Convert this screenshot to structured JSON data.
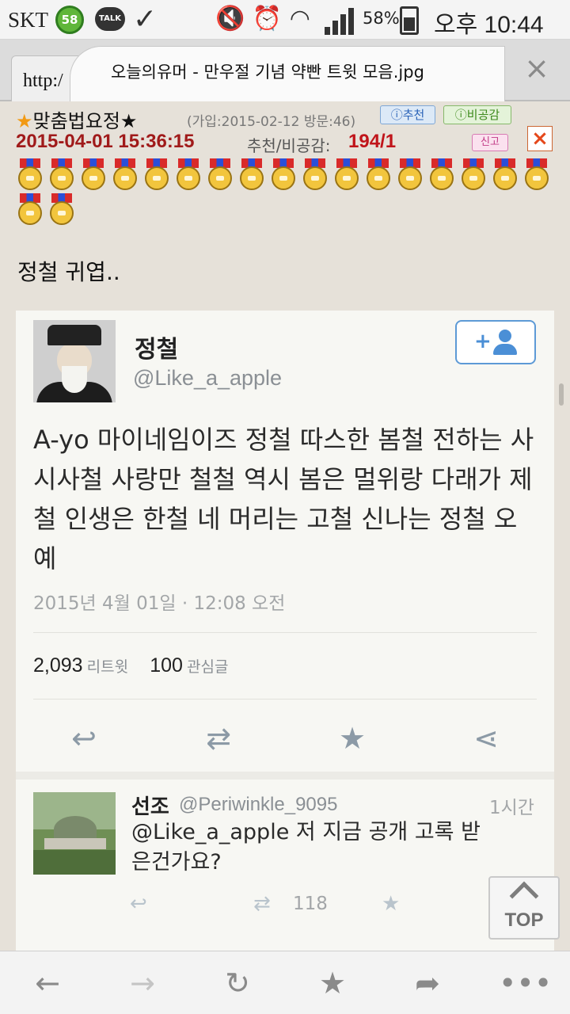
{
  "status_bar": {
    "carrier": "SKT",
    "badge": "58",
    "talk": "TALK",
    "battery_pct": "58%",
    "time": "오후 10:44"
  },
  "browser": {
    "url_stub": "http:/",
    "tab_title": "오늘의유머 - 만우절 기념 약빤 트윗 모음.jpg",
    "close": "×"
  },
  "post": {
    "nickname": "맞춤법요정",
    "join_info": "(가입:2015-02-12 방문:46)",
    "recommend_badge": "추천",
    "unempathy_badge": "비공감",
    "date": "2015-04-01 15:36:15",
    "rec_label": "추천/비공감:",
    "rec_value": "194/1",
    "report": "신고",
    "delete": "×",
    "caption": "정철 귀엽.."
  },
  "tweet": {
    "display_name": "정철",
    "handle": "@Like_a_apple",
    "text": "A-yo 마이네임이즈 정철 따스한 봄철 전하는 사시사철 사랑만 철철 역시 봄은 멀위랑 다래가 제철 인생은 한철 네 머리는 고철 신나는 정철 오예",
    "timestamp": "2015년 4월 01일 · 12:08 오전",
    "retweets": "2,093",
    "retweets_label": "리트윗",
    "favorites": "100",
    "favorites_label": "관심글"
  },
  "reply": {
    "name": "선조",
    "handle": "@Periwinkle_9095",
    "time": "1시간",
    "text": "@Like_a_apple 저 지금 공개 고록 받은건가요?",
    "retweet_count": "118"
  },
  "top_button": "TOP",
  "icons": {
    "reply": "reply-icon",
    "retweet": "retweet-icon",
    "favorite": "star-icon",
    "share": "share-icon",
    "back": "back-arrow-icon",
    "forward": "forward-arrow-icon",
    "reload": "reload-icon",
    "bookmark": "bookmark-star-icon",
    "more": "more-icon"
  },
  "colors": {
    "date_red": "#a01a1a",
    "rec_red": "#c0141a",
    "twitter_blue": "#4b8fd6",
    "page_bg": "#e6e1d9"
  }
}
